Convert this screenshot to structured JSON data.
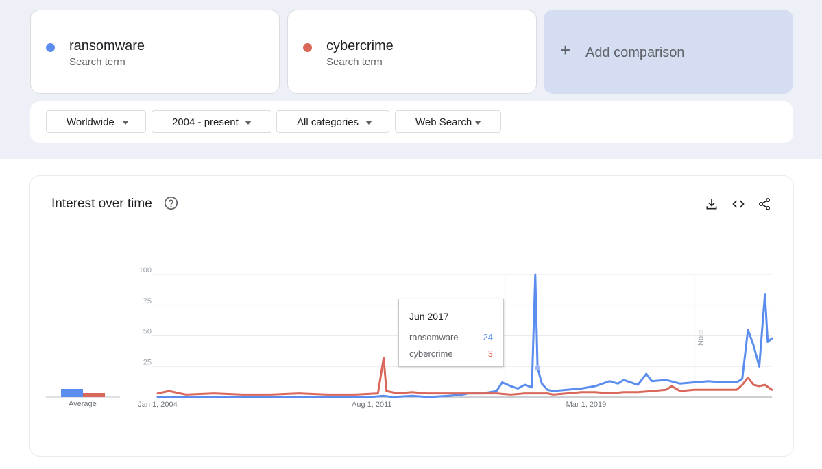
{
  "terms": [
    {
      "name": "ransomware",
      "sublabel": "Search term",
      "color": "#5b8def"
    },
    {
      "name": "cybercrime",
      "sublabel": "Search term",
      "color": "#d9675a"
    }
  ],
  "add_comparison": {
    "label": "Add comparison"
  },
  "filters": {
    "region": "Worldwide",
    "time_range": "2004 - present",
    "category": "All categories",
    "search_type": "Web Search"
  },
  "panel": {
    "title": "Interest over time",
    "icons": [
      "help-icon",
      "download-icon",
      "embed-code-icon",
      "share-icon"
    ]
  },
  "tooltip": {
    "date": "Jun 2017",
    "rows": [
      {
        "name": "ransomware",
        "value": "24"
      },
      {
        "name": "cybercrime",
        "value": "3"
      }
    ]
  },
  "average": {
    "label": "Average",
    "ransomware": 6,
    "cybercrime": 3
  },
  "chart_data": {
    "type": "line",
    "y_ticks": [
      100,
      75,
      50,
      25
    ],
    "ylim": [
      0,
      100
    ],
    "x_tick_labels": [
      "Jan 1, 2004",
      "Aug 1, 2011",
      "Mar 1, 2019"
    ],
    "annotation": "Note",
    "grid": true,
    "series": [
      {
        "name": "ransomware",
        "color": "#5b8def",
        "points": [
          [
            2004.0,
            0
          ],
          [
            2011.5,
            0
          ],
          [
            2012.0,
            1
          ],
          [
            2012.3,
            0
          ],
          [
            2013.0,
            1
          ],
          [
            2013.6,
            0
          ],
          [
            2014.3,
            1
          ],
          [
            2014.8,
            2
          ],
          [
            2015.0,
            3
          ],
          [
            2015.5,
            3
          ],
          [
            2016.0,
            5
          ],
          [
            2016.2,
            12
          ],
          [
            2016.5,
            9
          ],
          [
            2016.75,
            7
          ],
          [
            2017.0,
            10
          ],
          [
            2017.25,
            8
          ],
          [
            2017.37,
            100
          ],
          [
            2017.45,
            24
          ],
          [
            2017.6,
            11
          ],
          [
            2017.8,
            6
          ],
          [
            2018.0,
            5
          ],
          [
            2018.5,
            6
          ],
          [
            2019.0,
            7
          ],
          [
            2019.5,
            9
          ],
          [
            2020.0,
            13
          ],
          [
            2020.3,
            11
          ],
          [
            2020.5,
            14
          ],
          [
            2021.0,
            10
          ],
          [
            2021.3,
            19
          ],
          [
            2021.5,
            13
          ],
          [
            2022.0,
            14
          ],
          [
            2022.5,
            11
          ],
          [
            2023.0,
            12
          ],
          [
            2023.5,
            13
          ],
          [
            2024.0,
            12
          ],
          [
            2024.5,
            12
          ],
          [
            2024.7,
            15
          ],
          [
            2024.9,
            55
          ],
          [
            2025.1,
            42
          ],
          [
            2025.3,
            25
          ],
          [
            2025.5,
            84
          ],
          [
            2025.6,
            45
          ],
          [
            2025.75,
            48
          ]
        ]
      },
      {
        "name": "cybercrime",
        "color": "#d9675a",
        "points": [
          [
            2004.0,
            3
          ],
          [
            2004.4,
            5
          ],
          [
            2005.0,
            2
          ],
          [
            2006.0,
            3
          ],
          [
            2007.0,
            2
          ],
          [
            2008.0,
            2
          ],
          [
            2009.0,
            3
          ],
          [
            2010.0,
            2
          ],
          [
            2011.0,
            2
          ],
          [
            2011.8,
            3
          ],
          [
            2012.0,
            32
          ],
          [
            2012.1,
            5
          ],
          [
            2012.5,
            3
          ],
          [
            2013.0,
            4
          ],
          [
            2013.5,
            3
          ],
          [
            2014.0,
            3
          ],
          [
            2014.5,
            3
          ],
          [
            2015.0,
            3
          ],
          [
            2015.5,
            3
          ],
          [
            2016.0,
            3
          ],
          [
            2016.5,
            2
          ],
          [
            2017.0,
            3
          ],
          [
            2017.45,
            3
          ],
          [
            2017.8,
            3
          ],
          [
            2018.0,
            2
          ],
          [
            2018.5,
            3
          ],
          [
            2019.0,
            4
          ],
          [
            2019.5,
            4
          ],
          [
            2020.0,
            3
          ],
          [
            2020.5,
            4
          ],
          [
            2021.0,
            4
          ],
          [
            2021.5,
            5
          ],
          [
            2022.0,
            6
          ],
          [
            2022.2,
            9
          ],
          [
            2022.5,
            5
          ],
          [
            2023.0,
            6
          ],
          [
            2023.5,
            6
          ],
          [
            2024.0,
            6
          ],
          [
            2024.5,
            6
          ],
          [
            2024.7,
            10
          ],
          [
            2024.9,
            16
          ],
          [
            2025.1,
            10
          ],
          [
            2025.3,
            9
          ],
          [
            2025.5,
            10
          ],
          [
            2025.75,
            6
          ]
        ]
      }
    ]
  }
}
